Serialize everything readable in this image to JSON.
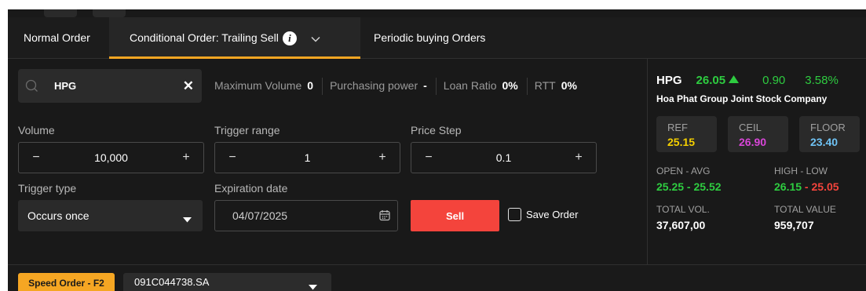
{
  "tabs": {
    "normal": "Normal Order",
    "conditional": "Conditional Order: Trailing Sell",
    "periodic": "Periodic buying Orders"
  },
  "search": {
    "value": "HPG",
    "clear": "✕"
  },
  "stats": {
    "max_volume_label": "Maximum Volume",
    "max_volume_value": "0",
    "purchasing_power_label": "Purchasing power",
    "purchasing_power_value": "-",
    "loan_ratio_label": "Loan Ratio",
    "loan_ratio_value": "0%",
    "rtt_label": "RTT",
    "rtt_value": "0%"
  },
  "form": {
    "volume": {
      "label": "Volume",
      "value": "10,000",
      "minus": "−",
      "plus": "+"
    },
    "trigger_range": {
      "label": "Trigger range",
      "value": "1",
      "minus": "−",
      "plus": "+"
    },
    "price_step": {
      "label": "Price Step",
      "value": "0.1",
      "minus": "−",
      "plus": "+"
    },
    "trigger_type": {
      "label": "Trigger type",
      "value": "Occurs once"
    },
    "expiration": {
      "label": "Expiration date",
      "value": "04/07/2025"
    },
    "sell_label": "Sell",
    "save_order_label": "Save Order"
  },
  "stock": {
    "symbol": "HPG",
    "price": "26.05",
    "change": "0.90",
    "change_pct": "3.58%",
    "name": "Hoa Phat Group Joint Stock Company",
    "ref_label": "REF",
    "ref_value": "25.15",
    "ceil_label": "CEIL",
    "ceil_value": "26.90",
    "floor_label": "FLOOR",
    "floor_value": "23.40",
    "open_avg_label": "OPEN - AVG",
    "open_avg_value": "25.25 - 25.52",
    "high_low_label": "HIGH - LOW",
    "high_value": "26.15",
    "low_value": "25.05",
    "high_low_sep": " - ",
    "total_vol_label": "TOTAL VOL.",
    "total_vol_value": "37,607,00",
    "total_value_label": "TOTAL VALUE",
    "total_value_value": "959,707"
  },
  "bottom": {
    "speed_order_label": "Speed Order - F2",
    "account": "091C044738.SA"
  },
  "colors": {
    "accent": "#f5a623",
    "sell": "#f4443c",
    "up": "#2ecc40",
    "ref": "#f5d000",
    "ceil": "#d946d9",
    "floor": "#6fc3f5",
    "down": "#f4443c"
  },
  "icons": {
    "search": "search-icon",
    "info": "info-icon",
    "chevron": "chevron-down-icon",
    "caret": "caret-down-icon",
    "calendar": "calendar-icon",
    "up": "triangle-up-icon"
  }
}
